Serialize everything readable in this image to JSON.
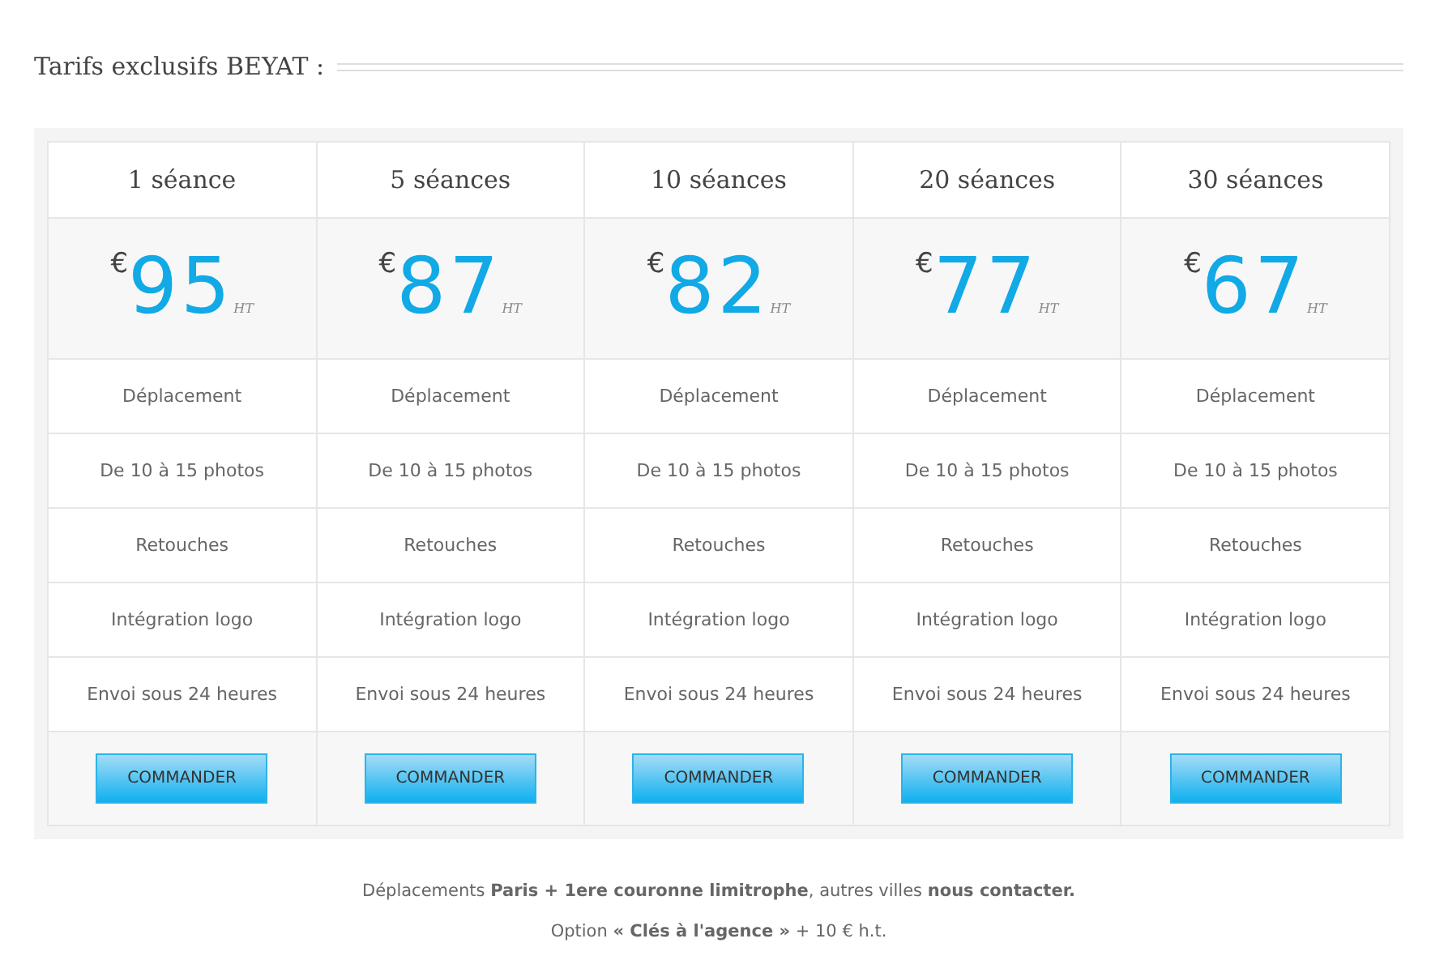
{
  "heading": "Tarifs exclusifs BEYAT :",
  "plans": [
    {
      "name": "1 séance",
      "currency": "€",
      "price": "95",
      "tax": "HT",
      "features": [
        "Déplacement",
        "De 10 à 15 photos",
        "Retouches",
        "Intégration logo",
        "Envoi sous 24 heures"
      ],
      "button": "COMMANDER"
    },
    {
      "name": "5 séances",
      "currency": "€",
      "price": "87",
      "tax": "HT",
      "features": [
        "Déplacement",
        "De 10 à 15 photos",
        "Retouches",
        "Intégration logo",
        "Envoi sous 24 heures"
      ],
      "button": "COMMANDER"
    },
    {
      "name": "10 séances",
      "currency": "€",
      "price": "82",
      "tax": "HT",
      "features": [
        "Déplacement",
        "De 10 à 15 photos",
        "Retouches",
        "Intégration logo",
        "Envoi sous 24 heures"
      ],
      "button": "COMMANDER"
    },
    {
      "name": "20 séances",
      "currency": "€",
      "price": "77",
      "tax": "HT",
      "features": [
        "Déplacement",
        "De 10 à 15 photos",
        "Retouches",
        "Intégration logo",
        "Envoi sous 24 heures"
      ],
      "button": "COMMANDER"
    },
    {
      "name": "30 séances",
      "currency": "€",
      "price": "67",
      "tax": "HT",
      "features": [
        "Déplacement",
        "De 10 à 15 photos",
        "Retouches",
        "Intégration logo",
        "Envoi sous 24 heures"
      ],
      "button": "COMMANDER"
    }
  ],
  "notes": [
    "Déplacements **Paris + 1ere couronne limitrophe**, autres villes **nous contacter.**",
    "Option **« Clés à l'agence »** + 10 € h.t."
  ]
}
